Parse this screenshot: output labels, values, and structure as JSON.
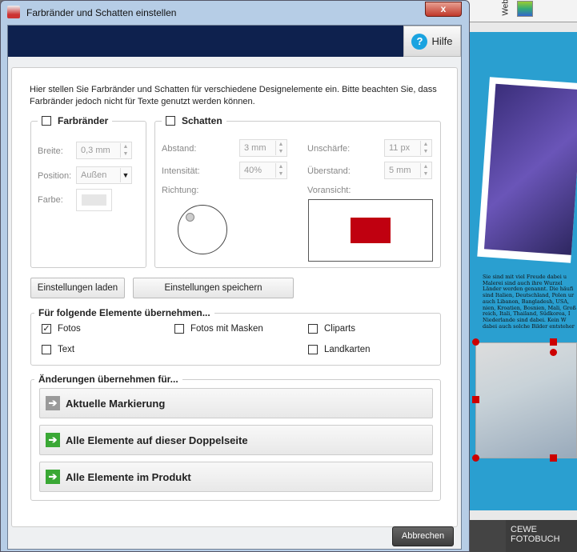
{
  "window": {
    "title": "Farbränder und Schatten einstellen",
    "close": "x",
    "help": "Hilfe"
  },
  "intro": "Hier stellen Sie Farbränder und Schatten für verschiedene Designelemente ein. Bitte beachten Sie, dass Farbränder jedoch nicht für Texte genutzt werden können.",
  "farbraender": {
    "title": "Farbränder",
    "checked": false,
    "breite_label": "Breite:",
    "breite": "0,3 mm",
    "position_label": "Position:",
    "position": "Außen",
    "farbe_label": "Farbe:"
  },
  "schatten": {
    "title": "Schatten",
    "checked": false,
    "abstand_label": "Abstand:",
    "abstand": "3 mm",
    "intensitaet_label": "Intensität:",
    "intensitaet": "40%",
    "richtung_label": "Richtung:",
    "unschaerfe_label": "Unschärfe:",
    "unschaerfe": "11 px",
    "ueberstand_label": "Überstand:",
    "ueberstand": "5 mm",
    "voransicht_label": "Voransicht:",
    "preview_color": "#c00010"
  },
  "buttons": {
    "load": "Einstellungen laden",
    "save": "Einstellungen speichern",
    "cancel": "Abbrechen"
  },
  "elements": {
    "title": "Für folgende Elemente übernehmen...",
    "items": [
      {
        "label": "Fotos",
        "checked": true
      },
      {
        "label": "Fotos mit Masken",
        "checked": false
      },
      {
        "label": "Cliparts",
        "checked": false
      },
      {
        "label": "Text",
        "checked": false
      },
      {
        "label": "Landkarten",
        "checked": false
      }
    ]
  },
  "apply": {
    "title": "Änderungen übernehmen für...",
    "options": [
      {
        "label": "Aktuelle Markierung",
        "color": "#9a9a9a"
      },
      {
        "label": "Alle Elemente auf dieser Doppelseite",
        "color": "#3aa835"
      },
      {
        "label": "Alle Elemente im Produkt",
        "color": "#3aa835"
      }
    ]
  },
  "background": {
    "toolbar_label": "Web",
    "page_text": [
      "Sie sind mit viel Freude dabei u",
      "Malerei sind auch ihre Wurzel",
      "Länder werden genannt. Die häufi",
      "sind Italien, Deutschland, Polen ur",
      "auch Libanon, Bangladesh, USA,",
      "nien, Kroatien, Bosnien, Mali, Groß",
      "reich, Itali, Thailand, Südkorea, I",
      "Niederlande sind dabei. Kein W",
      "dabei auch solche Bilder entsteher"
    ],
    "product": "CEWE FOTOBUCH"
  }
}
